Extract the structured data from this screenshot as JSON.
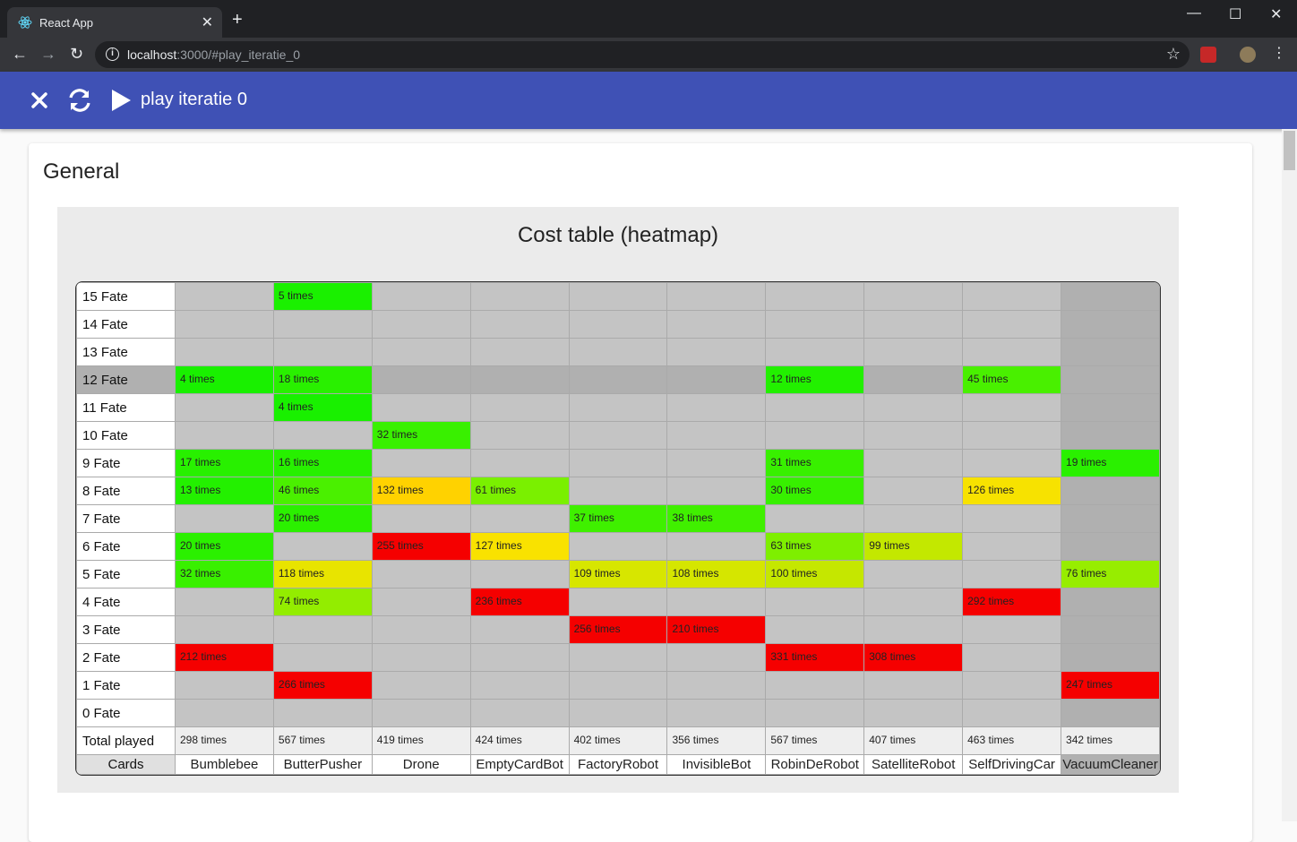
{
  "browser": {
    "tab_title": "React App",
    "tab_close": "✕",
    "new_tab": "+",
    "url_host": "localhost",
    "url_rest": ":3000/#play_iteratie_0",
    "window_controls": [
      "—",
      "☐",
      "✕"
    ]
  },
  "appbar": {
    "title": "play iteratie 0",
    "color": "#3f51b5"
  },
  "card": {
    "heading": "General",
    "panel_title": "Cost table (heatmap)"
  },
  "heatmap": {
    "highlight_row": "12 Fate",
    "highlight_column": "VacuumCleaner",
    "columns": [
      "Bumblebee",
      "ButterPusher",
      "Drone",
      "EmptyCardBot",
      "FactoryRobot",
      "InvisibleBot",
      "RobinDeRobot",
      "SatelliteRobot",
      "SelfDrivingCar",
      "VacuumCleaner"
    ],
    "corner_label": "Cards",
    "total_label": "Total played",
    "totals": [
      "298 times",
      "567 times",
      "419 times",
      "424 times",
      "402 times",
      "356 times",
      "567 times",
      "407 times",
      "463 times",
      "342 times"
    ],
    "rows": [
      {
        "label": "15 Fate",
        "cells": [
          "",
          "5 times",
          "",
          "",
          "",
          "",
          "",
          "",
          "",
          ""
        ]
      },
      {
        "label": "14 Fate",
        "cells": [
          "",
          "",
          "",
          "",
          "",
          "",
          "",
          "",
          "",
          ""
        ]
      },
      {
        "label": "13 Fate",
        "cells": [
          "",
          "",
          "",
          "",
          "",
          "",
          "",
          "",
          "",
          ""
        ]
      },
      {
        "label": "12 Fate",
        "cells": [
          "4 times",
          "18 times",
          "",
          "",
          "",
          "",
          "12 times",
          "",
          "45 times",
          ""
        ]
      },
      {
        "label": "11 Fate",
        "cells": [
          "",
          "4 times",
          "",
          "",
          "",
          "",
          "",
          "",
          "",
          ""
        ]
      },
      {
        "label": "10 Fate",
        "cells": [
          "",
          "",
          "32 times",
          "",
          "",
          "",
          "",
          "",
          "",
          ""
        ]
      },
      {
        "label": "9 Fate",
        "cells": [
          "17 times",
          "16 times",
          "",
          "",
          "",
          "",
          "31 times",
          "",
          "",
          "19 times"
        ]
      },
      {
        "label": "8 Fate",
        "cells": [
          "13 times",
          "46 times",
          "132 times",
          "61 times",
          "",
          "",
          "30 times",
          "",
          "126 times",
          ""
        ]
      },
      {
        "label": "7 Fate",
        "cells": [
          "",
          "20 times",
          "",
          "",
          "37 times",
          "38 times",
          "",
          "",
          "",
          ""
        ]
      },
      {
        "label": "6 Fate",
        "cells": [
          "20 times",
          "",
          "255 times",
          "127 times",
          "",
          "",
          "63 times",
          "99 times",
          "",
          ""
        ]
      },
      {
        "label": "5 Fate",
        "cells": [
          "32 times",
          "118 times",
          "",
          "",
          "109 times",
          "108 times",
          "100 times",
          "",
          "",
          "76 times"
        ]
      },
      {
        "label": "4 Fate",
        "cells": [
          "",
          "74 times",
          "",
          "236 times",
          "",
          "",
          "",
          "",
          "292 times",
          ""
        ]
      },
      {
        "label": "3 Fate",
        "cells": [
          "",
          "",
          "",
          "",
          "256 times",
          "210 times",
          "",
          "",
          "",
          ""
        ]
      },
      {
        "label": "2 Fate",
        "cells": [
          "212 times",
          "",
          "",
          "",
          "",
          "",
          "331 times",
          "308 times",
          "",
          ""
        ]
      },
      {
        "label": "1 Fate",
        "cells": [
          "",
          "266 times",
          "",
          "",
          "",
          "",
          "",
          "",
          "",
          "247 times"
        ]
      },
      {
        "label": "0 Fate",
        "cells": [
          "",
          "",
          "",
          "",
          "",
          "",
          "",
          "",
          "",
          ""
        ]
      }
    ],
    "colors": {
      "empty": "#c4c4c4",
      "empty_highlight": "#b0b0b0",
      "low": "#19ff00",
      "mid": "#ffe400",
      "high": "#ff0000"
    }
  }
}
